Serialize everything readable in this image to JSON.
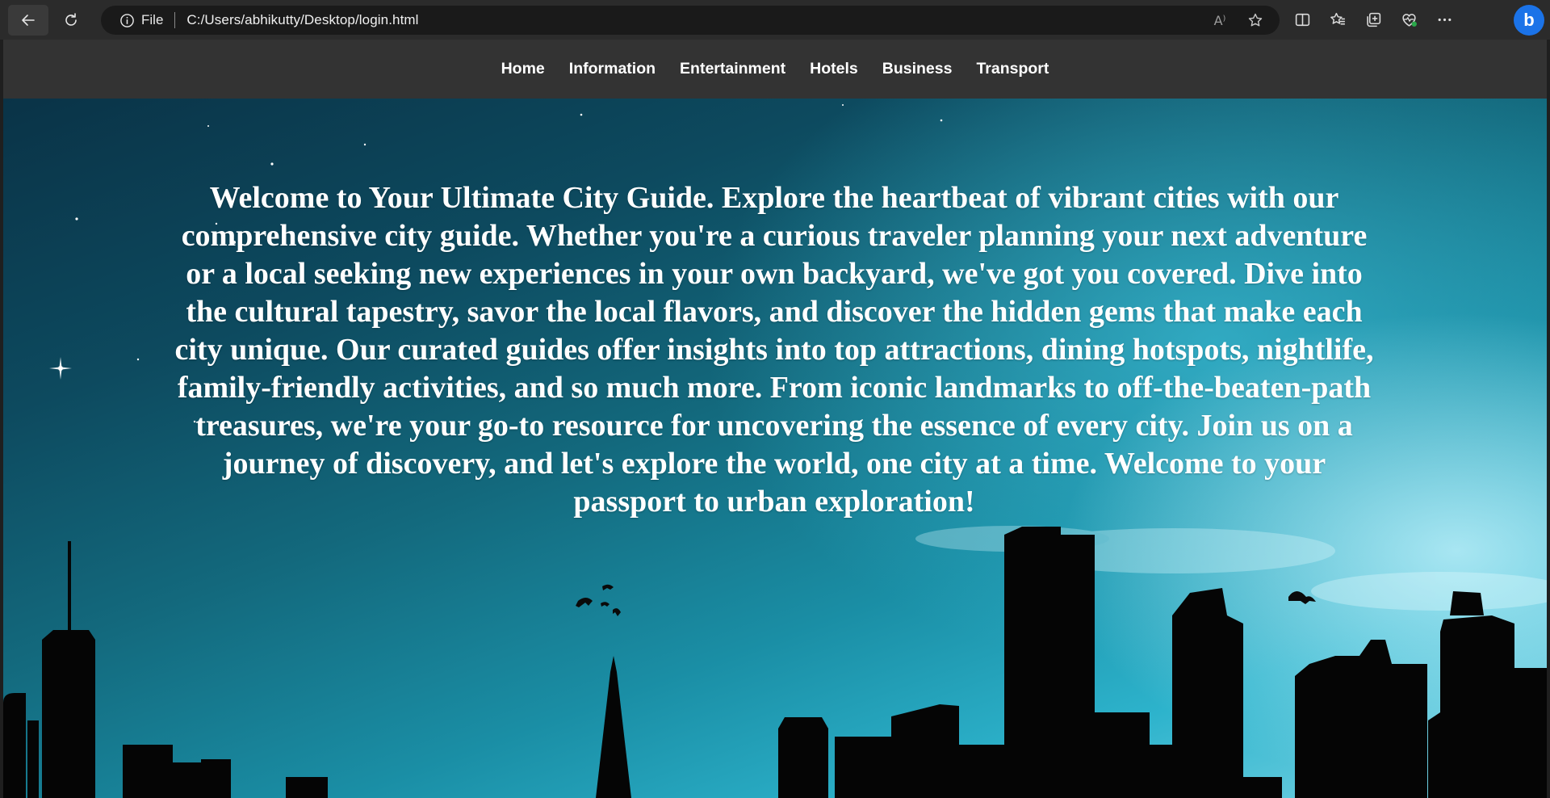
{
  "browser": {
    "address_scheme": "File",
    "address_url": "C:/Users/abhikutty/Desktop/login.html",
    "read_aloud_glyph": "A⁾",
    "copilot_glyph": "b"
  },
  "site_nav": {
    "items": [
      {
        "label": "Home"
      },
      {
        "label": "Information"
      },
      {
        "label": "Entertainment"
      },
      {
        "label": "Hotels"
      },
      {
        "label": "Business"
      },
      {
        "label": "Transport"
      }
    ]
  },
  "hero": {
    "text": "Welcome to Your Ultimate City Guide. Explore the heartbeat of vibrant cities with our comprehensive city guide. Whether you're a curious traveler planning your next adventure or a local seeking new experiences in your own backyard, we've got you covered. Dive into the cultural tapestry, savor the local flavors, and discover the hidden gems that make each city unique. Our curated guides offer insights into top attractions, dining hotspots, nightlife, family-friendly activities, and so much more. From iconic landmarks to off-the-beaten-path treasures, we're your go-to resource for uncovering the essence of every city. Join us on a journey of discovery, and let's explore the world, one city at a time. Welcome to your passport to urban exploration!"
  },
  "colors": {
    "chrome_bg": "#2b2b2b",
    "address_bg": "#1a1a1a",
    "nav_bg": "#333333",
    "copilot_accent": "#1b73e8",
    "sky_dark": "#0a3347",
    "sky_light": "#7fd6e6",
    "silhouette": "#050505"
  }
}
